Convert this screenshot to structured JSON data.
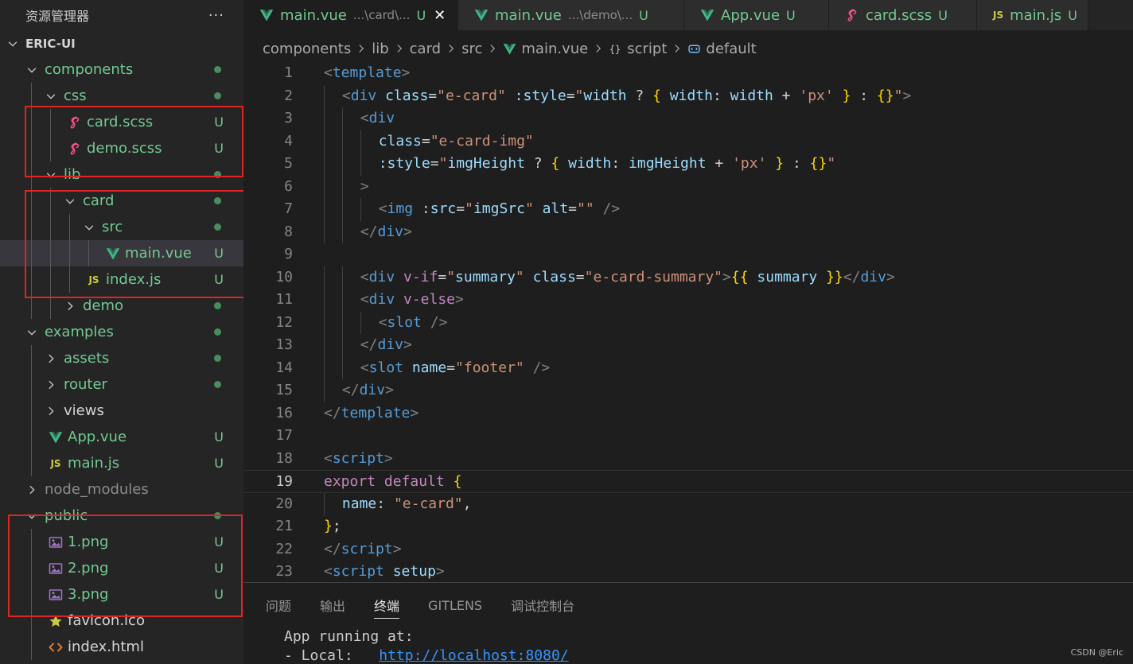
{
  "explorer": {
    "title": "资源管理器",
    "more": "···",
    "items": [
      {
        "label": "ERIC-UI",
        "depth": 0,
        "kind": "folder",
        "open": true,
        "root": true,
        "color": "white"
      },
      {
        "label": "components",
        "depth": 1,
        "kind": "folder",
        "open": true,
        "color": "green",
        "dot": true
      },
      {
        "label": "css",
        "depth": 2,
        "kind": "folder",
        "open": true,
        "color": "green",
        "dot": true
      },
      {
        "label": "card.scss",
        "depth": 3,
        "kind": "scss",
        "color": "green",
        "status": "U"
      },
      {
        "label": "demo.scss",
        "depth": 3,
        "kind": "scss",
        "color": "green",
        "status": "U"
      },
      {
        "label": "lib",
        "depth": 2,
        "kind": "folder",
        "open": true,
        "color": "green",
        "dot": true
      },
      {
        "label": "card",
        "depth": 3,
        "kind": "folder",
        "open": true,
        "color": "green",
        "dot": true
      },
      {
        "label": "src",
        "depth": 4,
        "kind": "folder",
        "open": true,
        "color": "green",
        "dot": true
      },
      {
        "label": "main.vue",
        "depth": 5,
        "kind": "vue",
        "color": "green",
        "status": "U",
        "selected": true
      },
      {
        "label": "index.js",
        "depth": 4,
        "kind": "js",
        "color": "green",
        "status": "U"
      },
      {
        "label": "demo",
        "depth": 3,
        "kind": "folder",
        "open": false,
        "color": "green",
        "dot": true
      },
      {
        "label": "examples",
        "depth": 1,
        "kind": "folder",
        "open": true,
        "color": "green",
        "dot": true
      },
      {
        "label": "assets",
        "depth": 2,
        "kind": "folder",
        "open": false,
        "color": "green",
        "dot": true
      },
      {
        "label": "router",
        "depth": 2,
        "kind": "folder",
        "open": false,
        "color": "green",
        "dot": true
      },
      {
        "label": "views",
        "depth": 2,
        "kind": "folder",
        "open": false,
        "color": "white"
      },
      {
        "label": "App.vue",
        "depth": 2,
        "kind": "vue",
        "color": "green",
        "status": "U"
      },
      {
        "label": "main.js",
        "depth": 2,
        "kind": "js",
        "color": "green",
        "status": "U"
      },
      {
        "label": "node_modules",
        "depth": 1,
        "kind": "folder",
        "open": false,
        "color": "gray"
      },
      {
        "label": "public",
        "depth": 1,
        "kind": "folder",
        "open": true,
        "color": "green",
        "dot": true
      },
      {
        "label": "1.png",
        "depth": 2,
        "kind": "png",
        "color": "green",
        "status": "U"
      },
      {
        "label": "2.png",
        "depth": 2,
        "kind": "png",
        "color": "green",
        "status": "U"
      },
      {
        "label": "3.png",
        "depth": 2,
        "kind": "png",
        "color": "green",
        "status": "U"
      },
      {
        "label": "favicon.ico",
        "depth": 2,
        "kind": "ico",
        "color": "white"
      },
      {
        "label": "index.html",
        "depth": 2,
        "kind": "html",
        "color": "white"
      }
    ]
  },
  "tabs": [
    {
      "icon": "vue",
      "name": "main.vue",
      "desc": "...\\card\\...",
      "status": "U",
      "active": true,
      "close": "✕"
    },
    {
      "icon": "vue",
      "name": "main.vue",
      "desc": "...\\demo\\...",
      "status": "U"
    },
    {
      "icon": "vue",
      "name": "App.vue",
      "desc": "",
      "status": "U"
    },
    {
      "icon": "scss",
      "name": "card.scss",
      "desc": "",
      "status": "U"
    },
    {
      "icon": "js",
      "name": "main.js",
      "desc": "",
      "status": "U"
    }
  ],
  "breadcrumb": [
    {
      "label": "components",
      "icon": ""
    },
    {
      "label": "lib",
      "icon": ""
    },
    {
      "label": "card",
      "icon": ""
    },
    {
      "label": "src",
      "icon": ""
    },
    {
      "label": "main.vue",
      "icon": "vue"
    },
    {
      "label": "script",
      "icon": "braces"
    },
    {
      "label": "default",
      "icon": "symbol"
    }
  ],
  "code": {
    "current_line": 19,
    "lines": [
      {
        "n": "1",
        "indent": 0,
        "toks": [
          [
            "br",
            "<"
          ],
          [
            "tag",
            "template"
          ],
          [
            "br",
            ">"
          ]
        ]
      },
      {
        "n": "2",
        "indent": 1,
        "toks": [
          [
            "br",
            "<"
          ],
          [
            "tag",
            "div"
          ],
          [
            "pl",
            " "
          ],
          [
            "attr",
            "class"
          ],
          [
            "pl",
            "="
          ],
          [
            "str",
            "\"e-card\""
          ],
          [
            "pl",
            " "
          ],
          [
            "attr",
            ":style"
          ],
          [
            "pl",
            "="
          ],
          [
            "str",
            "\""
          ],
          [
            "attr",
            "width"
          ],
          [
            "pl",
            " ? "
          ],
          [
            "br1",
            "{"
          ],
          [
            "pl",
            " "
          ],
          [
            "attr",
            "width"
          ],
          [
            "pl",
            ": "
          ],
          [
            "attr",
            "width"
          ],
          [
            "pl",
            " + "
          ],
          [
            "str",
            "'px'"
          ],
          [
            "pl",
            " "
          ],
          [
            "br1",
            "}"
          ],
          [
            "pl",
            " : "
          ],
          [
            "br1",
            "{}"
          ],
          [
            "str",
            "\""
          ],
          [
            "br",
            ">"
          ]
        ]
      },
      {
        "n": "3",
        "indent": 2,
        "toks": [
          [
            "br",
            "<"
          ],
          [
            "tag",
            "div"
          ]
        ]
      },
      {
        "n": "4",
        "indent": 3,
        "toks": [
          [
            "attr",
            "class"
          ],
          [
            "pl",
            "="
          ],
          [
            "str",
            "\"e-card-img\""
          ]
        ]
      },
      {
        "n": "5",
        "indent": 3,
        "toks": [
          [
            "attr",
            ":style"
          ],
          [
            "pl",
            "="
          ],
          [
            "str",
            "\""
          ],
          [
            "attr",
            "imgHeight"
          ],
          [
            "pl",
            " ? "
          ],
          [
            "br1",
            "{"
          ],
          [
            "pl",
            " "
          ],
          [
            "attr",
            "width"
          ],
          [
            "pl",
            ": "
          ],
          [
            "attr",
            "imgHeight"
          ],
          [
            "pl",
            " + "
          ],
          [
            "str",
            "'px'"
          ],
          [
            "pl",
            " "
          ],
          [
            "br1",
            "}"
          ],
          [
            "pl",
            " : "
          ],
          [
            "br1",
            "{}"
          ],
          [
            "str",
            "\""
          ]
        ]
      },
      {
        "n": "6",
        "indent": 2,
        "toks": [
          [
            "br",
            ">"
          ]
        ]
      },
      {
        "n": "7",
        "indent": 3,
        "toks": [
          [
            "br",
            "<"
          ],
          [
            "tag",
            "img"
          ],
          [
            "pl",
            " "
          ],
          [
            "attr",
            ":src"
          ],
          [
            "pl",
            "="
          ],
          [
            "str",
            "\""
          ],
          [
            "attr",
            "imgSrc"
          ],
          [
            "str",
            "\""
          ],
          [
            "pl",
            " "
          ],
          [
            "attr",
            "alt"
          ],
          [
            "pl",
            "="
          ],
          [
            "str",
            "\"\""
          ],
          [
            "pl",
            " "
          ],
          [
            "br",
            "/>"
          ]
        ]
      },
      {
        "n": "8",
        "indent": 2,
        "toks": [
          [
            "br",
            "</"
          ],
          [
            "tag",
            "div"
          ],
          [
            "br",
            ">"
          ]
        ]
      },
      {
        "n": "9",
        "indent": 0,
        "toks": []
      },
      {
        "n": "10",
        "indent": 2,
        "toks": [
          [
            "br",
            "<"
          ],
          [
            "tag",
            "div"
          ],
          [
            "pl",
            " "
          ],
          [
            "dir",
            "v-if"
          ],
          [
            "pl",
            "="
          ],
          [
            "str",
            "\""
          ],
          [
            "attr",
            "summary"
          ],
          [
            "str",
            "\""
          ],
          [
            "pl",
            " "
          ],
          [
            "attr",
            "class"
          ],
          [
            "pl",
            "="
          ],
          [
            "str",
            "\"e-card-summary\""
          ],
          [
            "br",
            ">"
          ],
          [
            "br1",
            "{{"
          ],
          [
            "pl",
            " "
          ],
          [
            "attr",
            "summary"
          ],
          [
            "pl",
            " "
          ],
          [
            "br1",
            "}}"
          ],
          [
            "br",
            "</"
          ],
          [
            "tag",
            "div"
          ],
          [
            "br",
            ">"
          ]
        ]
      },
      {
        "n": "11",
        "indent": 2,
        "toks": [
          [
            "br",
            "<"
          ],
          [
            "tag",
            "div"
          ],
          [
            "pl",
            " "
          ],
          [
            "dir",
            "v-else"
          ],
          [
            "br",
            ">"
          ]
        ]
      },
      {
        "n": "12",
        "indent": 3,
        "toks": [
          [
            "br",
            "<"
          ],
          [
            "tag",
            "slot"
          ],
          [
            "pl",
            " "
          ],
          [
            "br",
            "/>"
          ]
        ]
      },
      {
        "n": "13",
        "indent": 2,
        "toks": [
          [
            "br",
            "</"
          ],
          [
            "tag",
            "div"
          ],
          [
            "br",
            ">"
          ]
        ]
      },
      {
        "n": "14",
        "indent": 2,
        "toks": [
          [
            "br",
            "<"
          ],
          [
            "tag",
            "slot"
          ],
          [
            "pl",
            " "
          ],
          [
            "attr",
            "name"
          ],
          [
            "pl",
            "="
          ],
          [
            "str",
            "\"footer\""
          ],
          [
            "pl",
            " "
          ],
          [
            "br",
            "/>"
          ]
        ]
      },
      {
        "n": "15",
        "indent": 1,
        "toks": [
          [
            "br",
            "</"
          ],
          [
            "tag",
            "div"
          ],
          [
            "br",
            ">"
          ]
        ]
      },
      {
        "n": "16",
        "indent": 0,
        "toks": [
          [
            "br",
            "</"
          ],
          [
            "tag",
            "template"
          ],
          [
            "br",
            ">"
          ]
        ]
      },
      {
        "n": "17",
        "indent": 0,
        "toks": []
      },
      {
        "n": "18",
        "indent": 0,
        "toks": [
          [
            "br",
            "<"
          ],
          [
            "tag",
            "script"
          ],
          [
            "br",
            ">"
          ]
        ]
      },
      {
        "n": "19",
        "indent": 0,
        "toks": [
          [
            "kw",
            "export"
          ],
          [
            "pl",
            " "
          ],
          [
            "kw",
            "default"
          ],
          [
            "pl",
            " "
          ],
          [
            "br1",
            "{"
          ]
        ]
      },
      {
        "n": "20",
        "indent": 1,
        "toks": [
          [
            "attr",
            "name"
          ],
          [
            "pl",
            ": "
          ],
          [
            "str",
            "\"e-card\""
          ],
          [
            "pl",
            ","
          ]
        ]
      },
      {
        "n": "21",
        "indent": 0,
        "toks": [
          [
            "br1",
            "}"
          ],
          [
            "pl",
            ";"
          ]
        ]
      },
      {
        "n": "22",
        "indent": 0,
        "toks": [
          [
            "br",
            "</"
          ],
          [
            "tag",
            "script"
          ],
          [
            "br",
            ">"
          ]
        ]
      },
      {
        "n": "23",
        "indent": 0,
        "toks": [
          [
            "br",
            "<"
          ],
          [
            "tag",
            "script"
          ],
          [
            "pl",
            " "
          ],
          [
            "attr",
            "setup"
          ],
          [
            "br",
            ">"
          ]
        ]
      }
    ]
  },
  "panel": {
    "tabs": [
      {
        "label": "问题",
        "active": false
      },
      {
        "label": "输出",
        "active": false
      },
      {
        "label": "终端",
        "active": true
      },
      {
        "label": "GITLENS",
        "active": false
      },
      {
        "label": "调试控制台",
        "active": false
      }
    ],
    "terminal": {
      "line1": "App running at:",
      "line2_prefix": "- Local:   ",
      "line2_link": "http://localhost:8080/"
    }
  },
  "watermark": "CSDN @Eric",
  "colors": {
    "untracked": "#73c991",
    "highlight_box": "#e02424",
    "vue_icon": "#41b883",
    "scss_icon": "#f55385",
    "image_icon": "#a074c4",
    "html_icon": "#e37933",
    "ico_icon": "#cbcb41"
  }
}
